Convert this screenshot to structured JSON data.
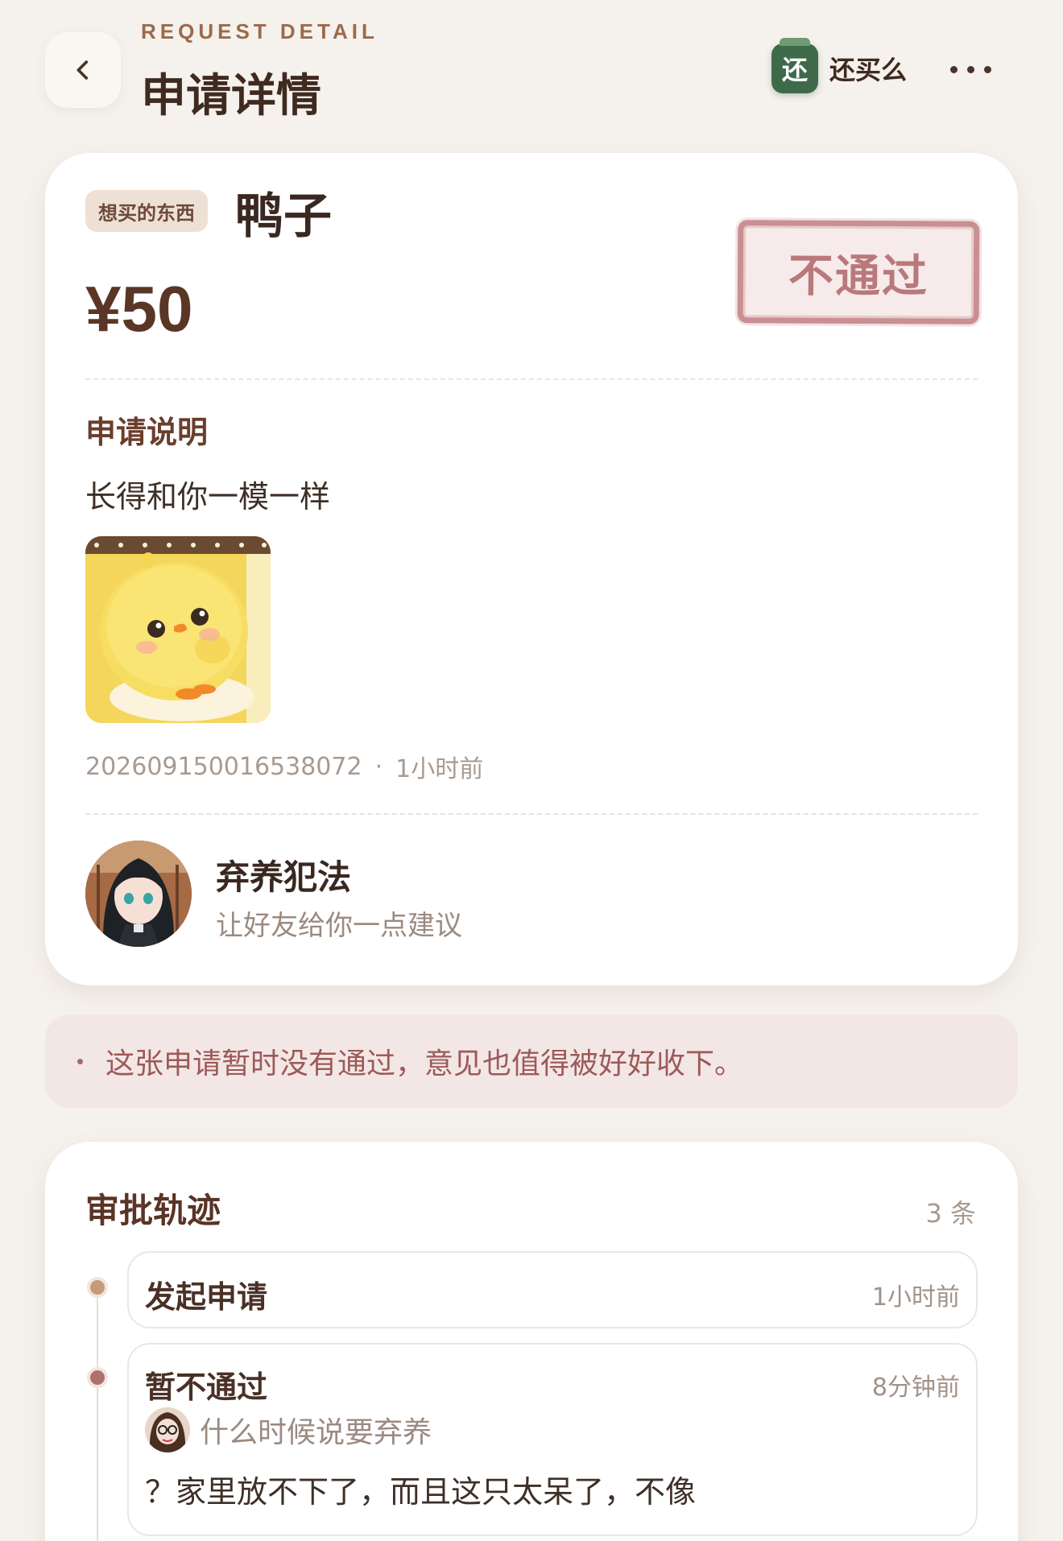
{
  "header": {
    "eyebrow": "REQUEST DETAIL",
    "title": "申请详情",
    "brand": {
      "badge": "还",
      "name": "还买么"
    }
  },
  "request": {
    "tag": "想买的东西",
    "item_name": "鸭子",
    "price": "¥50",
    "status_stamp": "不通过",
    "section_label": "申请说明",
    "description": "长得和你一模一样",
    "id": "20260915001653807​2",
    "time": "1小时前",
    "user": {
      "name": "弃养犯法",
      "subtitle": "让好友给你一点建议"
    }
  },
  "notice": {
    "text": "这张申请暂时没有通过，意见也值得被好好收下。"
  },
  "timeline": {
    "title": "审批轨迹",
    "count": "3 条",
    "items": [
      {
        "label": "发起申请",
        "time": "1小时前",
        "dot_color": "#c79a7c"
      },
      {
        "label": "暂不通过",
        "time": "8分钟前",
        "dot_color": "#b07070",
        "reviewer_note": "什么时候说要弃养",
        "body": "？家里放不下了，而且这只太呆了，不像"
      }
    ]
  },
  "colors": {
    "background": "#f5f1ec",
    "brand_green": "#3f6a4a",
    "stamp_red": "#b9797c",
    "notice_bg": "#f3e7e6"
  }
}
